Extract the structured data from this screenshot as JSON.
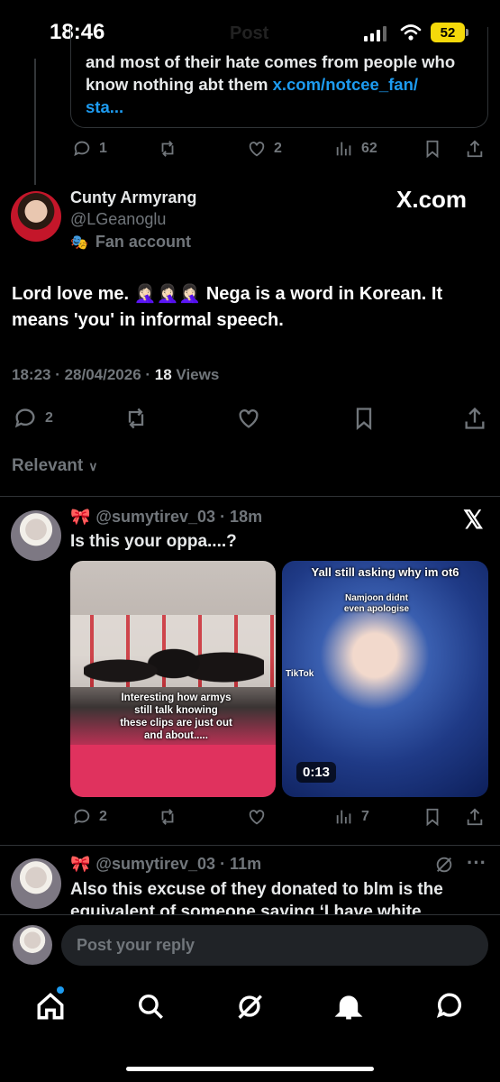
{
  "status_bar": {
    "time": "18:46",
    "ghost_title": "Post",
    "battery": "52"
  },
  "quote": {
    "text": "and most of their hate comes from people who know nothing abt them ",
    "link": "x.com/notcee_fan/",
    "link_tail": "sta..."
  },
  "top_actions": {
    "replies": "1",
    "likes": "2",
    "views": "62"
  },
  "main_tweet": {
    "display_name": "Cunty Armyrang",
    "handle": "@LGeanoglu",
    "label": "Fan account",
    "source": "X.com",
    "body": "Lord love me. 🤦🏻‍♀️🤦🏻‍♀️🤦🏻‍♀️ Nega is a word in Korean. It means 'you' in informal speech.",
    "time": "18:23 · 28/04/2026 · ",
    "views_count": "18",
    "views_label": " Views",
    "replies": "2"
  },
  "sort": {
    "label": "Relevant"
  },
  "reply1": {
    "handle": "@sumytirev_03",
    "time": " · 18m",
    "body": "Is this your oppa....?",
    "left_caption": "Interesting how armys still talk knowing these clips are just out and about.....",
    "right_caption_top": "Yall still asking why im ot6",
    "right_caption_sub": "Namjoon didnt even apologise",
    "tiktok": "TikTok",
    "duration": "0:13",
    "replies": "2",
    "views": "7"
  },
  "reply2": {
    "handle": "@sumytirev_03",
    "time": " · 11m",
    "body": "Also this excuse of they donated to blm is the equivalent of someone saying ‘I have white"
  },
  "composer": {
    "placeholder": "Post your reply"
  },
  "colors": {
    "accent": "#1d9bf0",
    "background": "#000000",
    "muted": "#71767b"
  }
}
